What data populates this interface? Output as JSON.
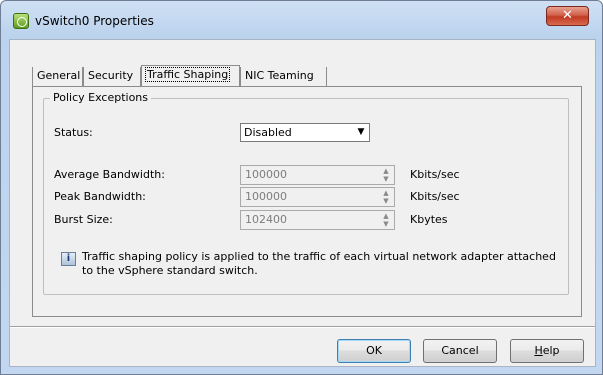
{
  "window": {
    "title": "vSwitch0 Properties",
    "close_glyph": "✕"
  },
  "tabs": [
    {
      "label": "General"
    },
    {
      "label": "Security"
    },
    {
      "label": "Traffic Shaping"
    },
    {
      "label": "NIC Teaming"
    }
  ],
  "active_tab": "Traffic Shaping",
  "policy": {
    "group_title": "Policy Exceptions",
    "status_label": "Status:",
    "status_value": "Disabled",
    "avg_label": "Average Bandwidth:",
    "avg_value": "100000",
    "avg_unit": "Kbits/sec",
    "peak_label": "Peak Bandwidth:",
    "peak_value": "100000",
    "peak_unit": "Kbits/sec",
    "burst_label": "Burst Size:",
    "burst_value": "102400",
    "burst_unit": "Kbytes",
    "info_text": "Traffic shaping policy is applied to the traffic of each virtual network adapter attached to the vSphere standard switch."
  },
  "buttons": {
    "ok": "OK",
    "cancel": "Cancel",
    "help_first": "H",
    "help_rest": "elp"
  },
  "icons": {
    "app": "vswitch-icon",
    "info": "info-icon",
    "dropdown": "chevron-down-icon"
  },
  "colors": {
    "title_bar": "#bcd3ee",
    "close_button": "#c03a22",
    "panel": "#f0f0f0"
  }
}
